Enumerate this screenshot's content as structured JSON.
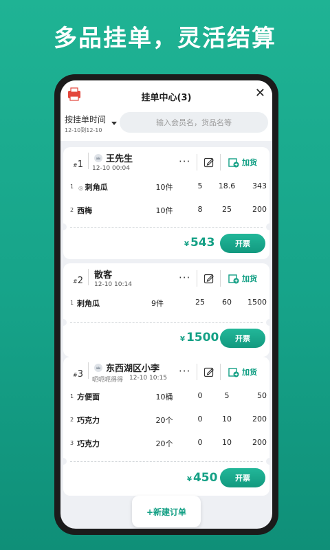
{
  "headline": "多品挂单，灵活结算",
  "header": {
    "title": "挂单中心(3)",
    "filter_label": "按挂单时间",
    "filter_range": "12-10到12-10",
    "search_placeholder": "输入会员名，货品名等",
    "app_icon_badge": "利润"
  },
  "orders": [
    {
      "no": "1",
      "customer": "王先生",
      "time": "12-10 00:04",
      "add_label": "加货",
      "items": [
        {
          "idx": "1",
          "name": "刺角瓜",
          "qty": "10件",
          "c1": "5",
          "c2": "18.6",
          "c3": "343"
        },
        {
          "idx": "2",
          "name": "西梅",
          "qty": "10件",
          "c1": "8",
          "c2": "25",
          "c3": "200"
        }
      ],
      "total": "543",
      "currency": "¥",
      "invoice_label": "开票"
    },
    {
      "no": "2",
      "customer": "散客",
      "time": "12-10 10:14",
      "add_label": "加货",
      "items": [
        {
          "idx": "1",
          "name": "刺角瓜",
          "qty": "9件",
          "c1": "25",
          "c2": "60",
          "c3": "1500"
        }
      ],
      "total": "1500",
      "currency": "¥",
      "invoice_label": "开票"
    },
    {
      "no": "3",
      "customer": "东西湖区小李",
      "subtitle": "呃呃呃得得",
      "time": "12-10 10:15",
      "add_label": "加货",
      "items": [
        {
          "idx": "1",
          "name": "方便面",
          "qty": "10桶",
          "c1": "0",
          "c2": "5",
          "c3": "50"
        },
        {
          "idx": "2",
          "name": "巧克力",
          "qty": "20个",
          "c1": "0",
          "c2": "10",
          "c3": "200"
        },
        {
          "idx": "3",
          "name": "巧克力",
          "qty": "20个",
          "c1": "0",
          "c2": "10",
          "c3": "200"
        }
      ],
      "total": "450",
      "currency": "¥",
      "invoice_label": "开票"
    }
  ],
  "new_order_label": "+新建订单",
  "icons": {
    "more": "more-dots-icon",
    "edit": "edit-icon",
    "add": "add-goods-icon",
    "crown": "member-crown-icon",
    "close": "close-icon"
  },
  "colors": {
    "accent": "#14a085",
    "background": "#1aa88e"
  }
}
